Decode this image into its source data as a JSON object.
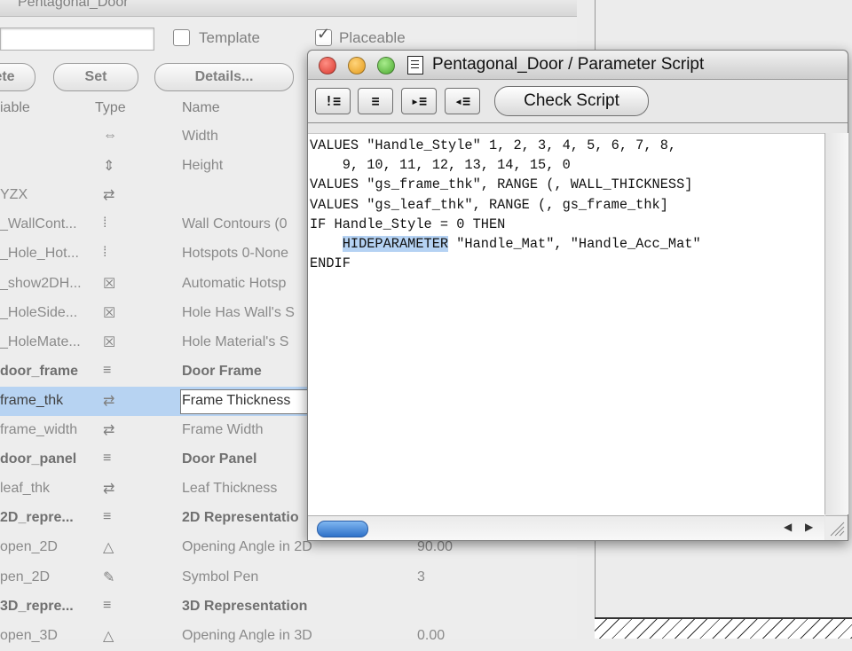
{
  "background_window": {
    "title": "Pentagonal_Door",
    "template_label": "Template",
    "placeable_label": "Placeable",
    "buttons": [
      "ete",
      "Set",
      "Details..."
    ],
    "columns": {
      "variable": "iable",
      "type": "Type",
      "name": "Name"
    },
    "rows": [
      {
        "var": "",
        "icon": "⇔",
        "name": "Width",
        "value": ""
      },
      {
        "var": "",
        "icon": "⇕",
        "name": "Height",
        "value": ""
      },
      {
        "var": "YZX",
        "icon": "⇄",
        "name": "",
        "value": ""
      },
      {
        "var": "_WallCont...",
        "icon": "⁞",
        "name": "Wall Contours (0",
        "value": ""
      },
      {
        "var": "_Hole_Hot...",
        "icon": "⁞",
        "name": "Hotspots 0-None",
        "value": ""
      },
      {
        "var": "_show2DH...",
        "icon": "☒",
        "name": "Automatic Hotsp",
        "value": ""
      },
      {
        "var": "_HoleSide...",
        "icon": "☒",
        "name": "Hole Has Wall's S",
        "value": ""
      },
      {
        "var": "_HoleMate...",
        "icon": "☒",
        "name": "Hole Material's S",
        "value": ""
      },
      {
        "var": "door_frame",
        "icon": "≡",
        "name": "Door Frame",
        "value": "",
        "bold": true
      },
      {
        "var": "frame_thk",
        "icon": "⇄",
        "name": "Frame Thickness",
        "value": "",
        "selected": true
      },
      {
        "var": "frame_width",
        "icon": "⇄",
        "name": "Frame Width",
        "value": ""
      },
      {
        "var": "door_panel",
        "icon": "≡",
        "name": "Door Panel",
        "value": "",
        "bold": true
      },
      {
        "var": "leaf_thk",
        "icon": "⇄",
        "name": "Leaf Thickness",
        "value": ""
      },
      {
        "var": "2D_repre...",
        "icon": "≡",
        "name": "2D Representatio",
        "value": "",
        "bold": true
      },
      {
        "var": "open_2D",
        "icon": "△",
        "name": "Opening Angle in 2D",
        "value": "90.00"
      },
      {
        "var": "pen_2D",
        "icon": "✎",
        "name": "Symbol Pen",
        "value": "3"
      },
      {
        "var": "3D_repre...",
        "icon": "≡",
        "name": "3D Representation",
        "value": "",
        "bold": true
      },
      {
        "var": "open_3D",
        "icon": "△",
        "name": "Opening Angle in 3D",
        "value": "0.00"
      }
    ]
  },
  "script_window": {
    "title": "Pentagonal_Door / Parameter Script",
    "toolbar_buttons": [
      "!≡",
      "≡",
      "▸≡",
      "◂≡"
    ],
    "check_script_label": "Check Script",
    "code_lines": [
      "VALUES \"Handle_Style\" 1, 2, 3, 4, 5, 6, 7, 8,",
      "    9, 10, 11, 12, 13, 14, 15, 0",
      "VALUES \"gs_frame_thk\", RANGE (, WALL_THICKNESS]",
      "VALUES \"gs_leaf_thk\", RANGE (, gs_frame_thk]",
      "IF Handle_Style = 0 THEN",
      "    HIDEPARAMETER \"Handle_Mat\", \"Handle_Acc_Mat\"",
      "ENDIF"
    ],
    "highlighted_word": "HIDEPARAMETER"
  },
  "colors": {
    "traffic_red": "#e2463c",
    "traffic_yellow": "#f2b233",
    "traffic_green": "#5cbf3f",
    "selection": "#b5d2f3",
    "scroll_thumb": "#3a7fd5"
  }
}
